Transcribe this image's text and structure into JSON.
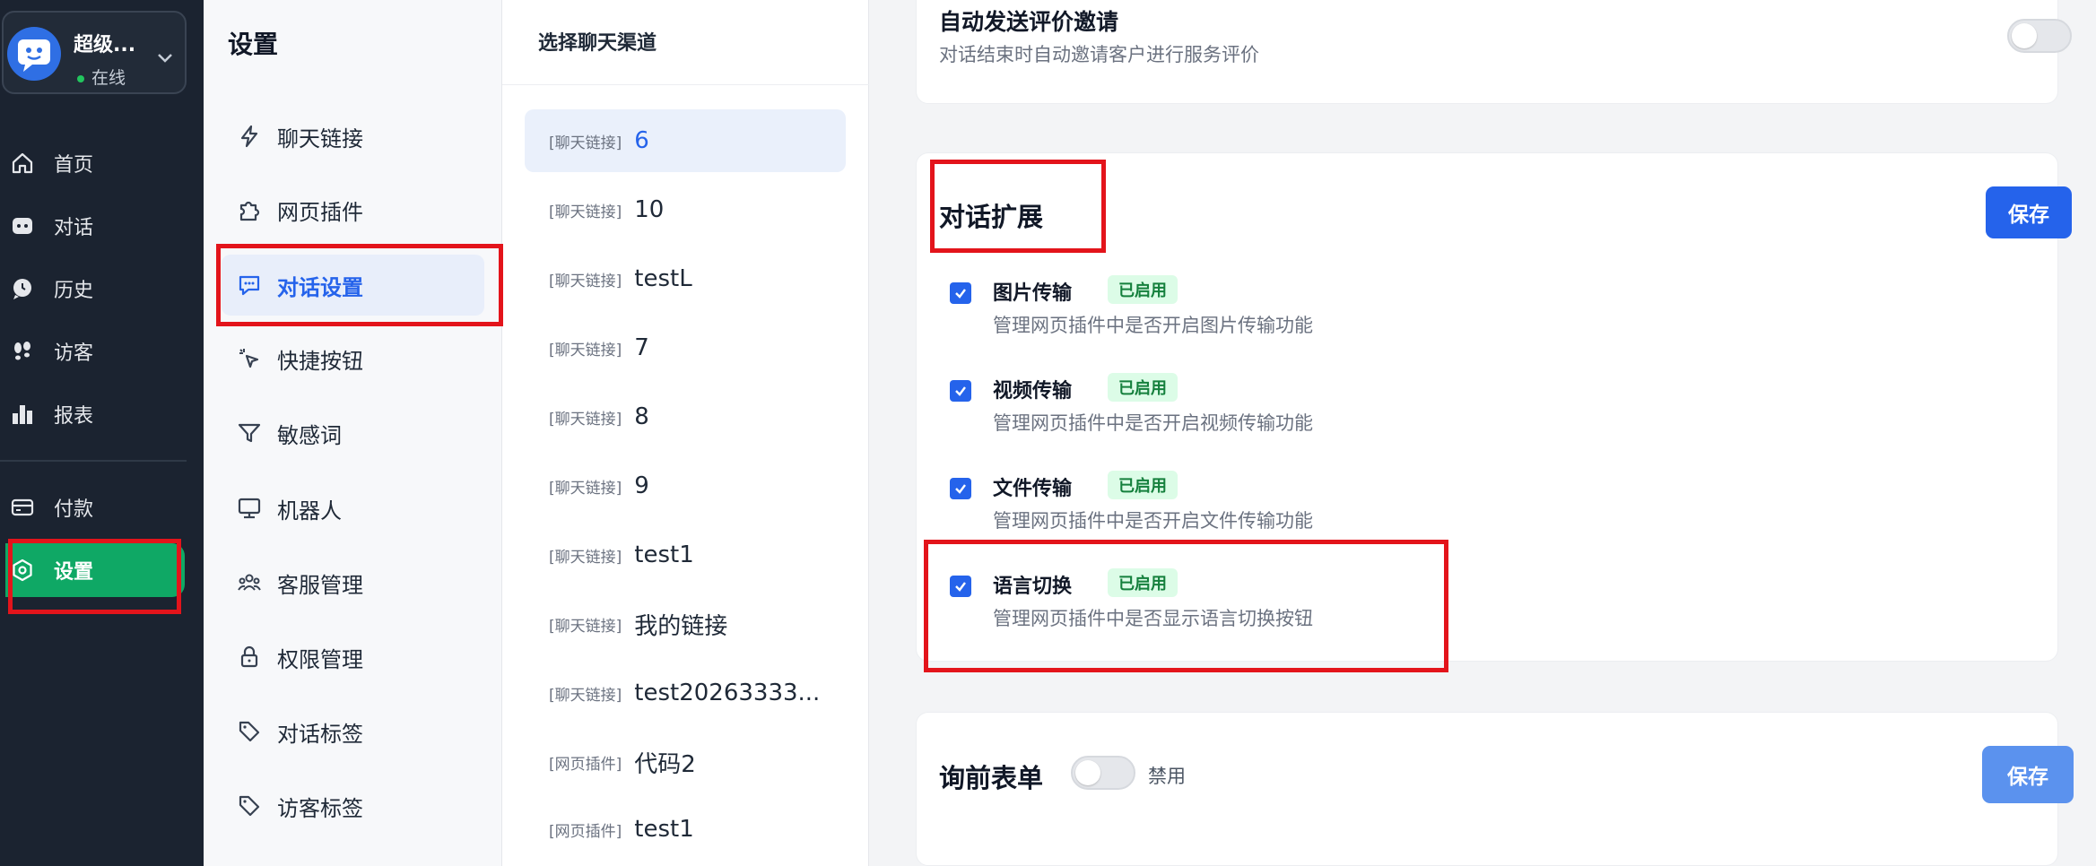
{
  "profile": {
    "name": "超级...",
    "status": "在线"
  },
  "nav": {
    "items": [
      {
        "label": "首页",
        "icon": "home-icon"
      },
      {
        "label": "对话",
        "icon": "chat-icon"
      },
      {
        "label": "历史",
        "icon": "history-icon"
      },
      {
        "label": "访客",
        "icon": "footprints-icon"
      },
      {
        "label": "报表",
        "icon": "bar-chart-icon"
      },
      {
        "label": "付款",
        "icon": "credit-card-icon"
      },
      {
        "label": "设置",
        "icon": "settings-icon",
        "active": true
      }
    ]
  },
  "settings": {
    "title": "设置",
    "items": [
      {
        "label": "聊天链接",
        "icon": "lightning-icon"
      },
      {
        "label": "网页插件",
        "icon": "puzzle-icon"
      },
      {
        "label": "对话设置",
        "icon": "message-settings-icon",
        "active": true
      },
      {
        "label": "快捷按钮",
        "icon": "cursor-click-icon"
      },
      {
        "label": "敏感词",
        "icon": "filter-icon"
      },
      {
        "label": "机器人",
        "icon": "monitor-icon"
      },
      {
        "label": "客服管理",
        "icon": "users-icon"
      },
      {
        "label": "权限管理",
        "icon": "lock-icon"
      },
      {
        "label": "对话标签",
        "icon": "tag-icon"
      },
      {
        "label": "访客标签",
        "icon": "tag-icon"
      }
    ]
  },
  "channels": {
    "title": "选择聊天渠道",
    "items": [
      {
        "tag": "[聊天链接]",
        "name": "6",
        "active": true
      },
      {
        "tag": "[聊天链接]",
        "name": "10"
      },
      {
        "tag": "[聊天链接]",
        "name": "testL"
      },
      {
        "tag": "[聊天链接]",
        "name": "7"
      },
      {
        "tag": "[聊天链接]",
        "name": "8"
      },
      {
        "tag": "[聊天链接]",
        "name": "9"
      },
      {
        "tag": "[聊天链接]",
        "name": "test1"
      },
      {
        "tag": "[聊天链接]",
        "name": "我的链接"
      },
      {
        "tag": "[聊天链接]",
        "name": "test20263333..."
      },
      {
        "tag": "[网页插件]",
        "name": "代码2"
      },
      {
        "tag": "[网页插件]",
        "name": "test1"
      }
    ]
  },
  "main": {
    "auto_invite": {
      "title": "自动发送评价邀请",
      "desc": "对话结束时自动邀请客户进行服务评价",
      "enabled": false
    },
    "extension": {
      "title": "对话扩展",
      "save_label": "保存",
      "options": [
        {
          "title": "图片传输",
          "badge": "已启用",
          "desc": "管理网页插件中是否开启图片传输功能",
          "checked": true
        },
        {
          "title": "视频传输",
          "badge": "已启用",
          "desc": "管理网页插件中是否开启视频传输功能",
          "checked": true
        },
        {
          "title": "文件传输",
          "badge": "已启用",
          "desc": "管理网页插件中是否开启文件传输功能",
          "checked": true
        },
        {
          "title": "语言切换",
          "badge": "已启用",
          "desc": "管理网页插件中是否显示语言切换按钮",
          "checked": true
        }
      ]
    },
    "pre_form": {
      "title": "询前表单",
      "toggle_label": "禁用",
      "enabled": false,
      "save_label": "保存"
    }
  },
  "colors": {
    "nav_bg": "#1b2330",
    "nav_active": "#0fa865",
    "accent": "#2563eb",
    "badge_bg": "#dcfce7",
    "badge_text": "#15803d",
    "highlight": "#e3141b"
  }
}
